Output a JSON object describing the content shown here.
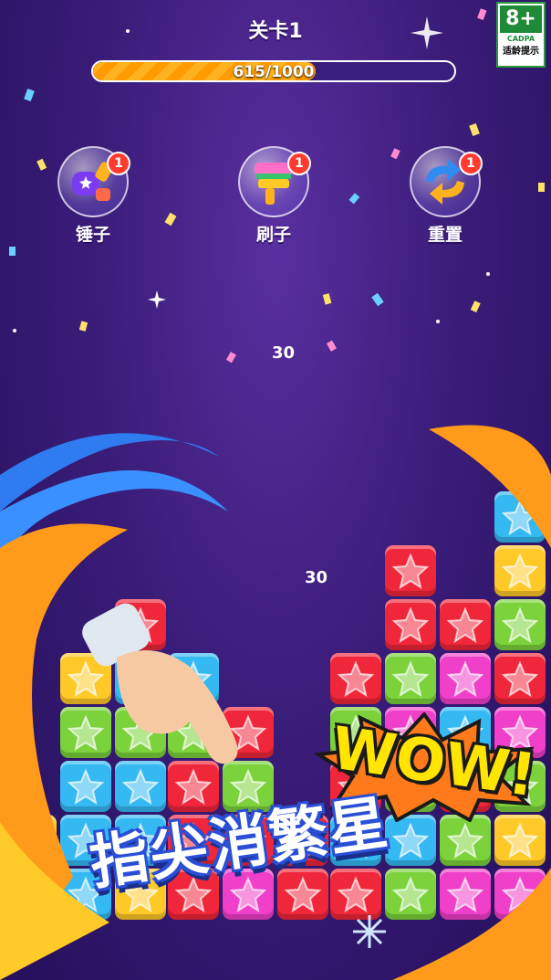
{
  "header": {
    "level_title": "关卡1"
  },
  "progress": {
    "current": 615,
    "target": 1000,
    "text_current": "615",
    "text_sep": "/1000",
    "fraction": 0.615
  },
  "age_rating": {
    "number": "8+",
    "org": "CADPA",
    "tip": "适龄提示"
  },
  "tools": [
    {
      "label": "锤子",
      "count": "1",
      "icon": "hammer-icon"
    },
    {
      "label": "刷子",
      "count": "1",
      "icon": "brush-icon"
    },
    {
      "label": "重置",
      "count": "1",
      "icon": "reset-icon"
    }
  ],
  "score_popups": [
    "30",
    "30"
  ],
  "banner": {
    "headline": "指尖消繁星",
    "wow": "WOW!"
  },
  "colors": {
    "yellow": "#ffc928",
    "pink": "#f03fc8",
    "blue": "#35b9f2",
    "red": "#f0263a",
    "green": "#7bd23a",
    "orange": "#ff9a1a"
  },
  "board": {
    "columns": [
      [
        "pink",
        "yellow"
      ],
      [
        "blue",
        "blue",
        "blue",
        "green",
        "yellow"
      ],
      [
        "yellow",
        "blue",
        "blue",
        "green",
        "blue",
        "red"
      ],
      [
        "red",
        "red",
        "red",
        "green",
        "blue"
      ],
      [
        "pink",
        "red",
        "green",
        "red"
      ],
      [
        "red",
        "red"
      ],
      [
        "red",
        "blue",
        "red",
        "green",
        "red"
      ],
      [
        "green",
        "blue",
        "green",
        "pink",
        "green",
        "red",
        "red"
      ],
      [
        "pink",
        "green",
        "red",
        "blue",
        "pink",
        "red"
      ],
      [
        "pink",
        "yellow",
        "green",
        "pink",
        "red",
        "green",
        "yellow",
        "blue"
      ]
    ]
  }
}
